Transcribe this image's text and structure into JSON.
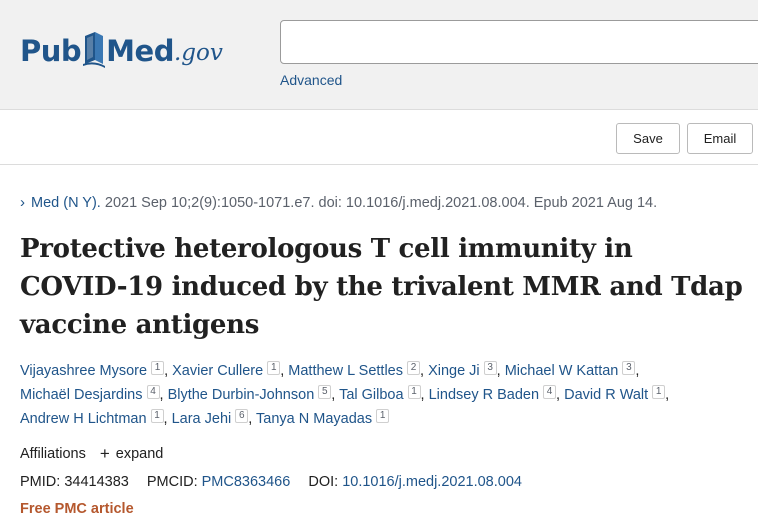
{
  "header": {
    "logo": {
      "pub": "Pub",
      "med": "Med",
      "gov": ".gov"
    },
    "search": {
      "value": "",
      "placeholder": ""
    },
    "advanced_label": "Advanced"
  },
  "actions": {
    "save_label": "Save",
    "email_label": "Email"
  },
  "article": {
    "citation": {
      "chevron": "›",
      "journal": "Med (N Y).",
      "details": "2021 Sep 10;2(9):1050-1071.e7. doi: 10.1016/j.medj.2021.08.004. Epub 2021 Aug 14."
    },
    "title": "Protective heterologous T cell immunity in COVID-19 induced by the trivalent MMR and Tdap vaccine antigens",
    "authors": [
      {
        "name": "Vijayashree Mysore",
        "aff": "1"
      },
      {
        "name": "Xavier Cullere",
        "aff": "1"
      },
      {
        "name": "Matthew L Settles",
        "aff": "2"
      },
      {
        "name": "Xinge Ji",
        "aff": "3"
      },
      {
        "name": "Michael W Kattan",
        "aff": "3"
      },
      {
        "name": "Michaël Desjardins",
        "aff": "4"
      },
      {
        "name": "Blythe Durbin-Johnson",
        "aff": "5"
      },
      {
        "name": "Tal Gilboa",
        "aff": "1"
      },
      {
        "name": "Lindsey R Baden",
        "aff": "4"
      },
      {
        "name": "David R Walt",
        "aff": "1"
      },
      {
        "name": "Andrew H Lichtman",
        "aff": "1"
      },
      {
        "name": "Lara Jehi",
        "aff": "6"
      },
      {
        "name": "Tanya N Mayadas",
        "aff": "1"
      }
    ],
    "affiliations_label": "Affiliations",
    "expand_label": "expand",
    "pmid_label": "PMID:",
    "pmid": "34414383",
    "pmcid_label": "PMCID:",
    "pmcid": "PMC8363466",
    "doi_label": "DOI:",
    "doi": "10.1016/j.medj.2021.08.004",
    "free_pmc_label": "Free PMC article"
  },
  "colors": {
    "brand": "#20558a",
    "free_article": "#b5582e",
    "header_bg": "#f1f1f1"
  }
}
